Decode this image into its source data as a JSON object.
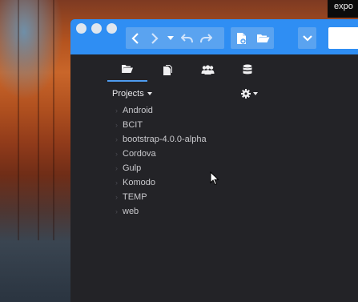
{
  "tooltip": {
    "text": "expo"
  },
  "toolbar": {
    "accent_color": "#2f8ef3",
    "nav_buttons": [
      {
        "icon": "chevron-left-icon"
      },
      {
        "icon": "chevron-right-icon"
      },
      {
        "icon": "dropdown-caret-icon"
      },
      {
        "icon": "undo-icon"
      },
      {
        "icon": "redo-icon"
      }
    ],
    "file_buttons": [
      {
        "icon": "new-file-icon"
      },
      {
        "icon": "open-folder-icon"
      }
    ],
    "menu_button": {
      "icon": "chevron-down-icon"
    },
    "search": {
      "value": "",
      "placeholder": ""
    }
  },
  "tabs": [
    {
      "icon": "folder-open-icon",
      "active": true
    },
    {
      "icon": "files-icon",
      "active": false
    },
    {
      "icon": "users-icon",
      "active": false
    },
    {
      "icon": "database-icon",
      "active": false
    }
  ],
  "projects": {
    "header_label": "Projects",
    "items": [
      "Android",
      "BCIT",
      "bootstrap-4.0.0-alpha",
      "Cordova",
      "Gulp",
      "Komodo",
      "TEMP",
      "web"
    ]
  }
}
